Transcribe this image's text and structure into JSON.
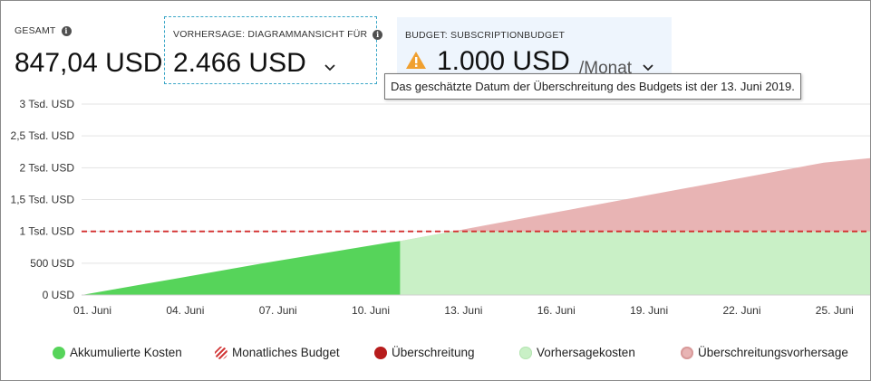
{
  "header": {
    "total": {
      "label": "GESAMT",
      "value": "847,04 USD",
      "icon": "info-icon"
    },
    "forecast": {
      "label": "VORHERSAGE: DIAGRAMMANSICHT FÜR",
      "value": "2.466 USD",
      "icon": "info-icon",
      "dropdown_icon": "chevron-down-icon"
    },
    "budget": {
      "label": "BUDGET: SUBSCRIPTIONBUDGET",
      "value": "1.000 USD",
      "period": "/Monat",
      "icon": "warning-icon",
      "dropdown_icon": "chevron-down-icon"
    }
  },
  "tooltip": {
    "text": "Das geschätzte Datum der Überschreitung des Budgets ist der 13. Juni 2019."
  },
  "colors": {
    "actual": "#56d45a",
    "forecast": "#c9f0c6",
    "overage": "#b71c1c",
    "overage_forecast": "#e8b4b4",
    "budget_line": "#d32f2f",
    "warning": "#f0a030"
  },
  "chart_data": {
    "type": "area",
    "y_ticks": [
      "0 USD",
      "500 USD",
      "1 Tsd. USD",
      "1,5 Tsd. USD",
      "2 Tsd. USD",
      "2,5 Tsd. USD",
      "3 Tsd. USD"
    ],
    "y_tick_values": [
      0,
      500,
      1000,
      1500,
      2000,
      2500,
      3000
    ],
    "x_ticks": [
      "01. Juni",
      "04. Juni",
      "07. Juni",
      "10. Juni",
      "13. Juni",
      "16. Juni",
      "19. Juni",
      "22. Juni",
      "25. Juni"
    ],
    "x_tick_days": [
      1,
      4,
      7,
      10,
      13,
      16,
      19,
      22,
      25
    ],
    "xlim": [
      1,
      26.5
    ],
    "ylim": [
      0,
      3000
    ],
    "grid": true,
    "budget": 1000,
    "series": [
      {
        "name": "Akkumulierte Kosten",
        "x": [
          1,
          2,
          3,
          4,
          5,
          6,
          7,
          8,
          9,
          10,
          11,
          11.3
        ],
        "y": [
          0,
          85,
          170,
          255,
          340,
          425,
          510,
          590,
          670,
          750,
          830,
          847
        ]
      },
      {
        "name": "Vorhersagekosten",
        "x": [
          11.3,
          13,
          16,
          19,
          22,
          25,
          26.5
        ],
        "y": [
          847,
          1000,
          1000,
          1000,
          1000,
          1000,
          1000
        ]
      },
      {
        "name": "Überschreitungsvorhersage",
        "x": [
          11.3,
          13,
          16,
          19,
          22,
          25,
          26.5
        ],
        "y": [
          847,
          1000,
          1270,
          1540,
          1810,
          2080,
          2150
        ]
      }
    ],
    "legend": {
      "placement": "bottom",
      "entries": [
        {
          "name": "Akkumulierte Kosten",
          "color": "#56d45a",
          "style": "solid"
        },
        {
          "name": "Monatliches Budget",
          "color": "#d23a3a",
          "style": "striped"
        },
        {
          "name": "Überschreitung",
          "color": "#b71c1c",
          "style": "solid"
        },
        {
          "name": "Vorhersagekosten",
          "color": "#c9f0c6",
          "style": "solid"
        },
        {
          "name": "Überschreitungsvorhersage",
          "color": "#e8b4b4",
          "style": "solid"
        }
      ]
    }
  }
}
